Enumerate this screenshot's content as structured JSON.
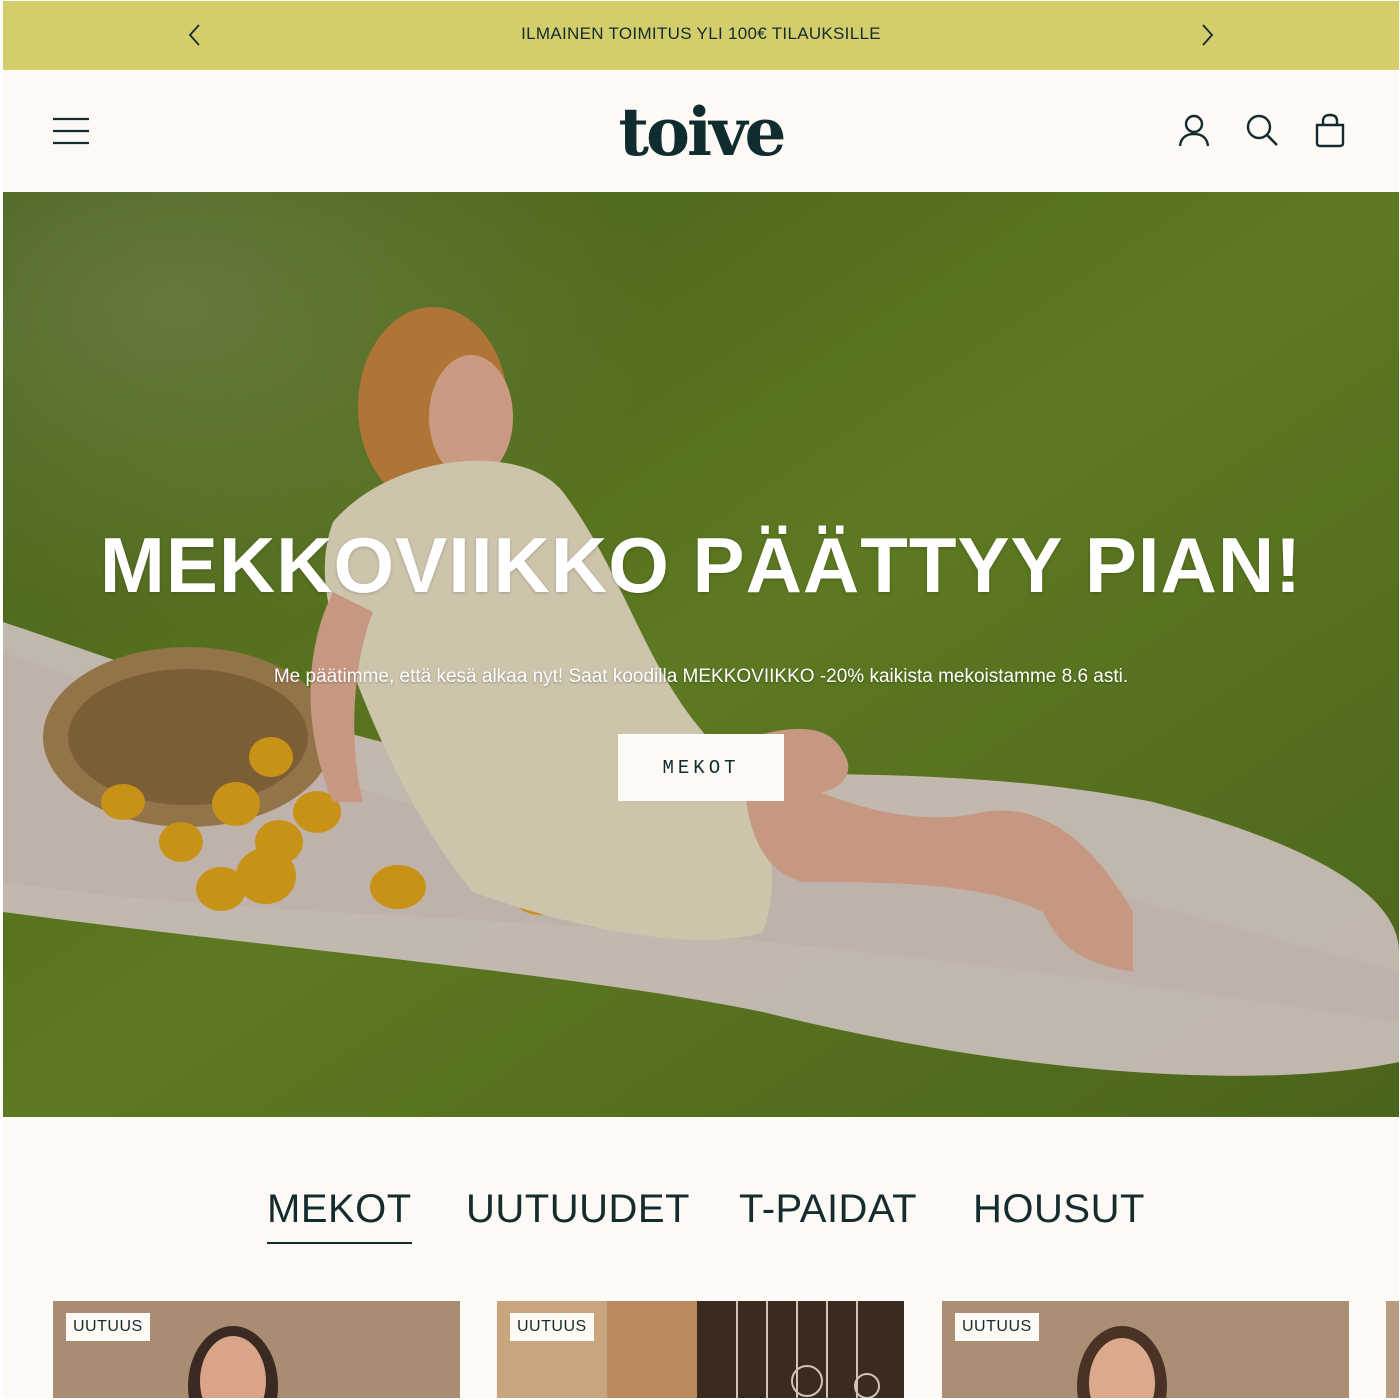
{
  "announcement": {
    "text": "ILMAINEN TOIMITUS YLI 100€ TILAUKSILLE",
    "prev_icon": "chevron-left-icon",
    "next_icon": "chevron-right-icon"
  },
  "header": {
    "logo": "toive",
    "menu_icon": "hamburger-menu-icon",
    "account_icon": "account-icon",
    "search_icon": "search-icon",
    "cart_icon": "shopping-bag-icon"
  },
  "hero": {
    "title": "MEKKOVIIKKO PÄÄTTYY PIAN!",
    "subtitle": "Me päätimme, että kesä alkaa nyt! Saat koodilla MEKKOVIIKKO -20% kaikista mekoistamme 8.6 asti.",
    "cta_label": "MEKOT"
  },
  "category_tabs": [
    {
      "label": "MEKOT",
      "active": true
    },
    {
      "label": "UUTUUDET",
      "active": false
    },
    {
      "label": "T-PAIDAT",
      "active": false
    },
    {
      "label": "HOUSUT",
      "active": false
    }
  ],
  "products": [
    {
      "badge": "UUTUUS"
    },
    {
      "badge": "UUTUUS"
    },
    {
      "badge": "UUTUUS"
    }
  ],
  "colors": {
    "announcement_bg": "#d3cd6c",
    "page_bg": "#fdfaf6",
    "text_dark": "#142c2e"
  }
}
